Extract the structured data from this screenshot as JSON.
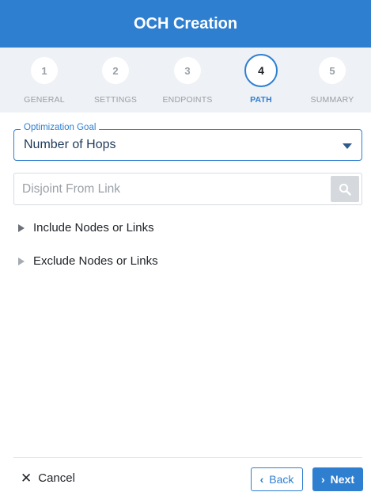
{
  "header": {
    "title": "OCH Creation"
  },
  "steps": [
    {
      "number": "1",
      "label": "GENERAL",
      "active": false
    },
    {
      "number": "2",
      "label": "SETTINGS",
      "active": false
    },
    {
      "number": "3",
      "label": "ENDPOINTS",
      "active": false
    },
    {
      "number": "4",
      "label": "PATH",
      "active": true
    },
    {
      "number": "5",
      "label": "SUMMARY",
      "active": false
    }
  ],
  "optimization": {
    "label": "Optimization Goal",
    "value": "Number of Hops"
  },
  "disjoint": {
    "placeholder": "Disjoint From Link",
    "value": ""
  },
  "expanders": {
    "include": "Include Nodes or Links",
    "exclude": "Exclude Nodes or Links"
  },
  "footer": {
    "cancel": "Cancel",
    "back": "Back",
    "next": "Next"
  },
  "colors": {
    "primary": "#2f7fd1",
    "stepper_bg": "#eef1f5"
  },
  "icons": {
    "cancel": "close-icon",
    "back": "chevron-left-icon",
    "next": "chevron-right-icon",
    "search": "search-icon",
    "dropdown": "caret-down-icon",
    "expander": "triangle-right-icon"
  }
}
